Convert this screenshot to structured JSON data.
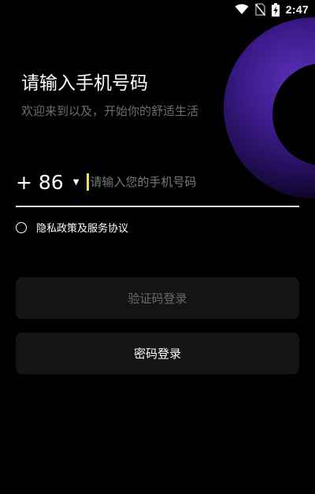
{
  "status_bar": {
    "time": "2:47",
    "icons": [
      "wifi-icon",
      "no-sim-icon",
      "battery-charging-icon"
    ]
  },
  "login": {
    "title": "请输入手机号码",
    "subtitle": "欢迎来到以及，开始你的舒适生活",
    "country_code": "+ 86",
    "phone_placeholder": "请输入您的手机号码",
    "phone_value": "",
    "agreement_label": "隐私政策及服务协议",
    "code_login_label": "验证码登录",
    "password_login_label": "密码登录"
  },
  "colors": {
    "background": "#000000",
    "accent_caret": "#f2e34a",
    "decor_purple": "#5a2fb8",
    "button_bg": "#141414",
    "disabled_text": "#6a6a6a"
  }
}
